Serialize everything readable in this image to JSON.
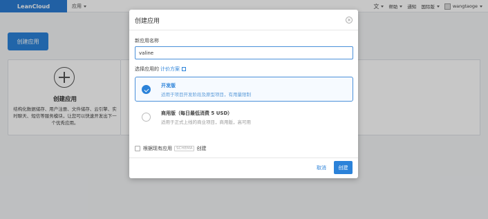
{
  "topbar": {
    "brand": "LeanCloud",
    "app_menu": "应用",
    "right": {
      "translate_icon": "文",
      "help": "帮助",
      "notifications": "通知",
      "region": "国际版",
      "username": "wangtaoge"
    }
  },
  "page": {
    "create_button": "创建应用",
    "card": {
      "title": "创建应用",
      "description": "结构化数据储存、用户注册、文件储存、云引擎、实时聊天、短信等服务模块，让您可以快速开发出下一个优秀应用。"
    }
  },
  "modal": {
    "title": "创建应用",
    "close": "×",
    "name_label": "新应用名称",
    "name_value": "valine",
    "plan_label": "选择应用的",
    "plan_link": "计价方案",
    "plans": [
      {
        "title": "开发版",
        "desc": "适用于项目开发阶段及原型项目，有用量限制",
        "selected": true
      },
      {
        "title": "商用版（每日最低消费 5 USD）",
        "desc": "适用于正式上线的商业项目，商用版，高可用",
        "selected": false
      }
    ],
    "existing_prefix": "根据现有应用",
    "existing_schema": "SCHEMA",
    "existing_suffix": "创建",
    "cancel": "取消",
    "submit": "创建"
  },
  "colors": {
    "brand": "#2b7cd3",
    "accent": "#2b82d9"
  }
}
